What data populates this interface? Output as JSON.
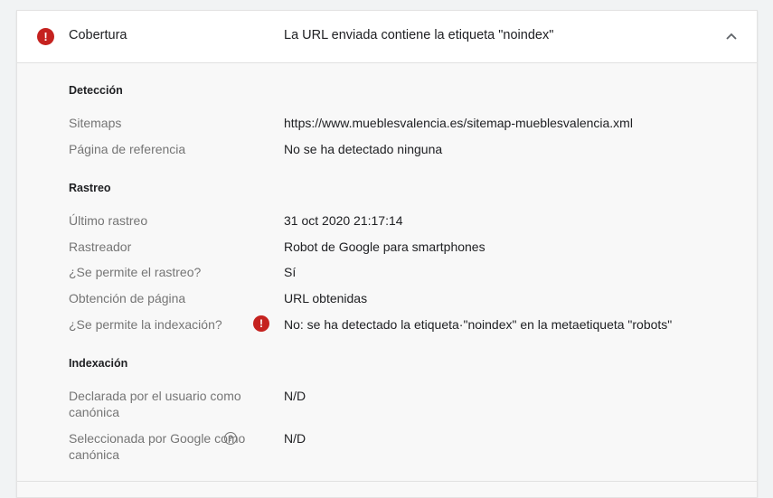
{
  "header": {
    "icon": "error-icon",
    "label": "Cobertura",
    "value": "La URL enviada contiene la etiqueta \"noindex\"",
    "collapse_icon": "chevron-up-icon"
  },
  "sections": {
    "deteccion": {
      "title": "Detección",
      "rows": [
        {
          "label": "Sitemaps",
          "value": "https://www.mueblesvalencia.es/sitemap-mueblesvalencia.xml"
        },
        {
          "label": "Página de referencia",
          "value": "No se ha detectado ninguna"
        }
      ]
    },
    "rastreo": {
      "title": "Rastreo",
      "rows": [
        {
          "label": "Último rastreo",
          "value": "31 oct 2020 21:17:14"
        },
        {
          "label": "Rastreador",
          "value": "Robot de Google para smartphones"
        },
        {
          "label": "¿Se permite el rastreo?",
          "value": "Sí"
        },
        {
          "label": "Obtención de página",
          "value": "URL obtenidas"
        },
        {
          "label": "¿Se permite la indexación?",
          "value": "No: se ha detectado la etiqueta·\"noindex\" en la metaetiqueta \"robots\"",
          "icon": "error-icon"
        }
      ]
    },
    "indexacion": {
      "title": "Indexación",
      "rows": [
        {
          "label": "Declarada por el usuario como canónica",
          "value": "N/D"
        },
        {
          "label": "Seleccionada por Google como canónica",
          "value": "N/D",
          "icon": "help-icon"
        }
      ]
    }
  },
  "colors": {
    "error": "#c5221f",
    "label": "#757575",
    "text": "#202124"
  }
}
